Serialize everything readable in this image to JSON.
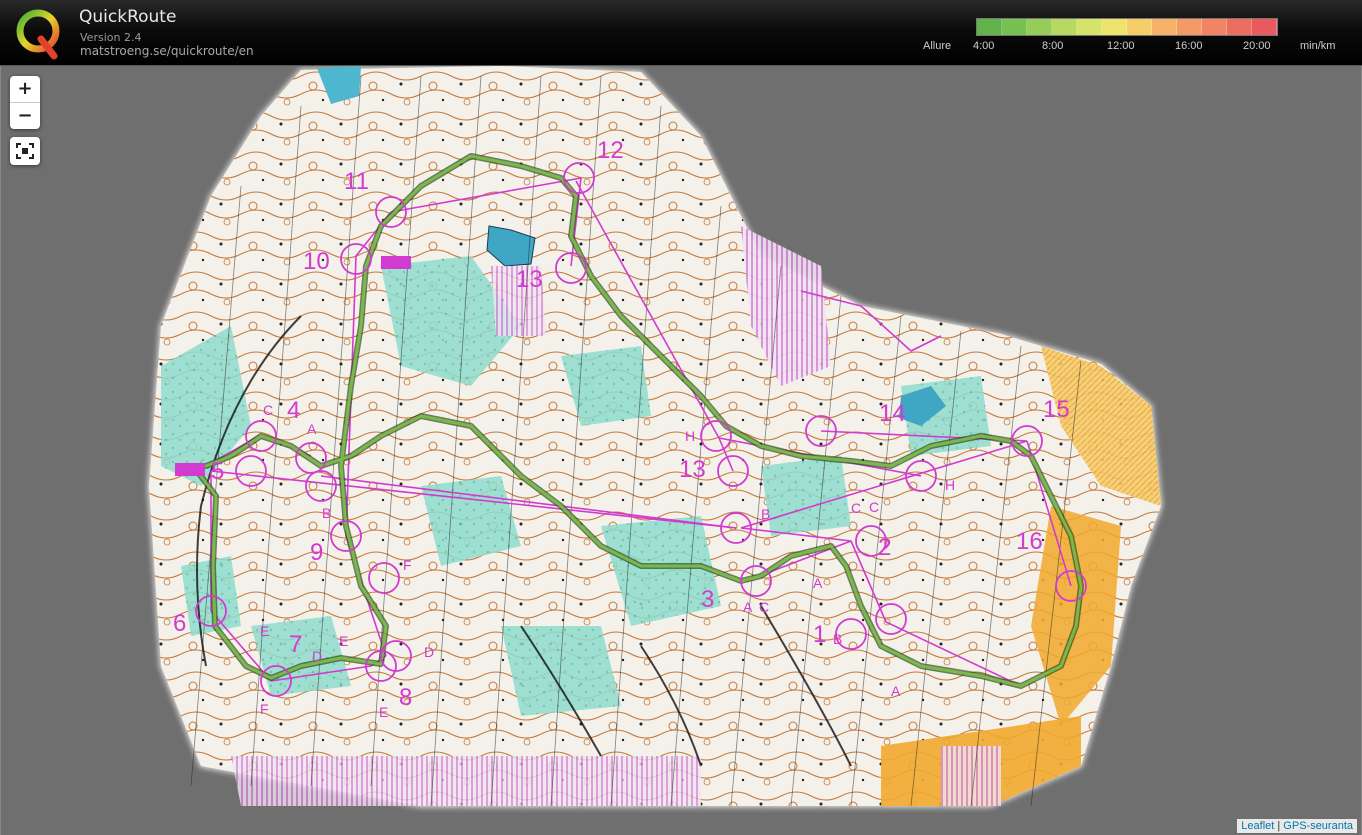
{
  "app": {
    "title": "QuickRoute",
    "version": "Version 2.4",
    "url": "matstroeng.se/quickroute/en"
  },
  "pace_legend": {
    "label": "Allure",
    "ticks": [
      "4:00",
      "8:00",
      "12:00",
      "16:00",
      "20:00"
    ],
    "unit": "min/km",
    "colors": [
      "#5fb34a",
      "#79c052",
      "#98cc5a",
      "#b8d862",
      "#d6e26a",
      "#eee36c",
      "#f6cd6a",
      "#f6b268",
      "#f49a66",
      "#f08464",
      "#ec6e62",
      "#e85a5e"
    ]
  },
  "map_controls": {
    "zoom_in": "+",
    "zoom_out": "−",
    "fit_icon": "fullscreen-fit-icon"
  },
  "attribution": {
    "leaflet": "Leaflet",
    "separator": " | ",
    "gps": "GPS-seuranta"
  },
  "controls": [
    {
      "num": "1",
      "codes": [
        "A",
        "B"
      ]
    },
    {
      "num": "2",
      "codes": [
        "A",
        "C"
      ]
    },
    {
      "num": "3",
      "codes": [
        "A",
        "C"
      ]
    },
    {
      "num": "4",
      "codes": [
        "A",
        "C"
      ]
    },
    {
      "num": "5",
      "codes": [
        "B"
      ]
    },
    {
      "num": "6",
      "codes": [
        "E",
        "F"
      ]
    },
    {
      "num": "7",
      "codes": [
        "D",
        "E"
      ]
    },
    {
      "num": "8",
      "codes": [
        "D",
        "E"
      ]
    },
    {
      "num": "9",
      "codes": [
        "F"
      ]
    },
    {
      "num": "10",
      "codes": []
    },
    {
      "num": "11",
      "codes": []
    },
    {
      "num": "12",
      "codes": []
    },
    {
      "num": "13",
      "codes": [
        "B",
        "H"
      ]
    },
    {
      "num": "14",
      "codes": [
        "C",
        "H"
      ]
    },
    {
      "num": "15",
      "codes": []
    },
    {
      "num": "16",
      "codes": []
    }
  ],
  "colors": {
    "course": "#d23ad0",
    "route": "#4f7f2f",
    "map_white": "#f3f0ea",
    "forest_green": "#7fd3c4",
    "contour": "#b5651d",
    "rough_open": "#f1a92d"
  }
}
